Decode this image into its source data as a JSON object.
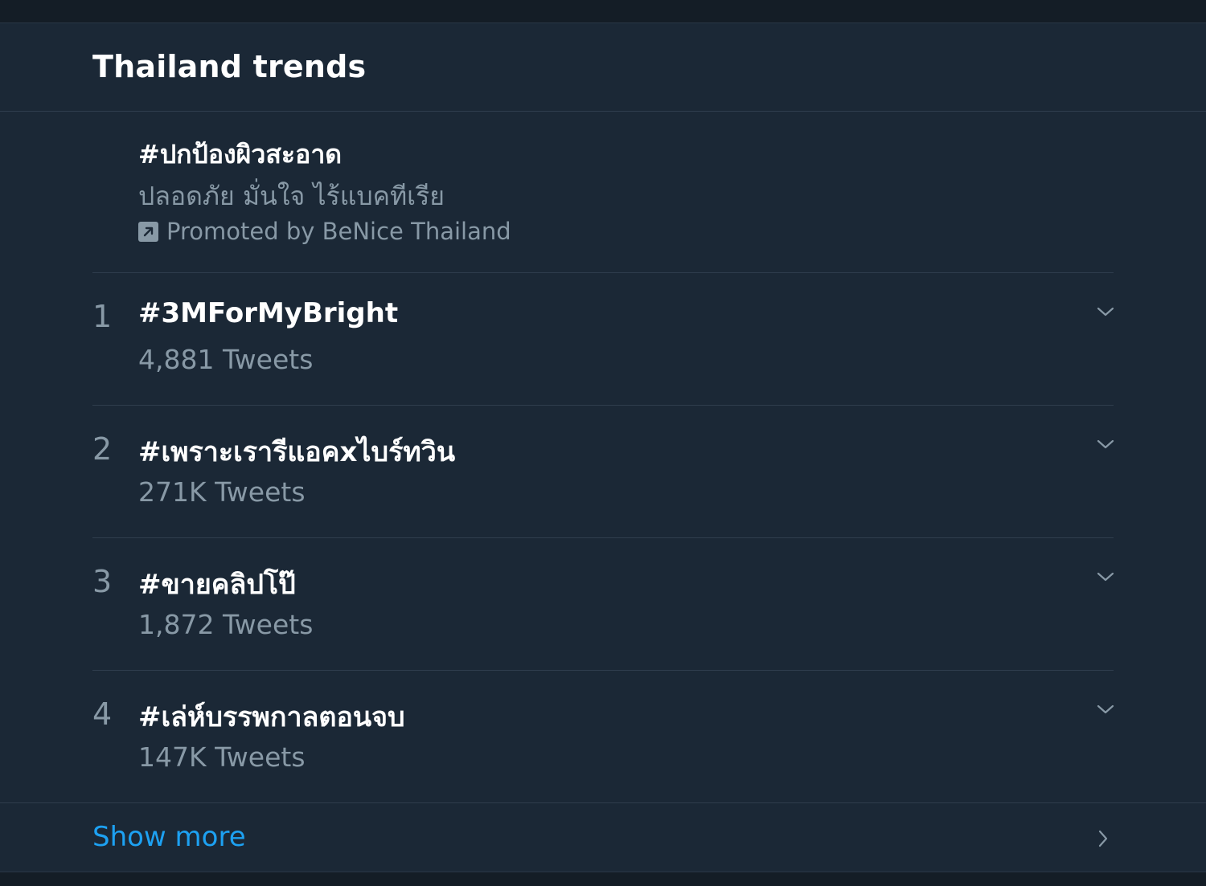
{
  "header": {
    "title": "Thailand trends"
  },
  "promoted": {
    "hashtag": "#ปกป้องผิวสะอาด",
    "description": "ปลอดภัย มั่นใจ ไร้แบคทีเรีย",
    "promoted_by": "Promoted by BeNice Thailand",
    "icon": "promoted-icon"
  },
  "trends": [
    {
      "rank": "1",
      "name": "#3MForMyBright",
      "count": "4,881 Tweets"
    },
    {
      "rank": "2",
      "name": "#เพราะเรารีแอคxไบร์ทวิน",
      "count": "271K Tweets"
    },
    {
      "rank": "3",
      "name": "#ขายคลิปโป๊",
      "count": "1,872 Tweets"
    },
    {
      "rank": "4",
      "name": "#เล่ห์บรรพกาลตอนจบ",
      "count": "147K Tweets"
    }
  ],
  "footer": {
    "show_more": "Show more"
  },
  "colors": {
    "background": "#1b2836",
    "text_primary": "#ffffff",
    "text_secondary": "#8899a6",
    "accent": "#1da1f2"
  }
}
